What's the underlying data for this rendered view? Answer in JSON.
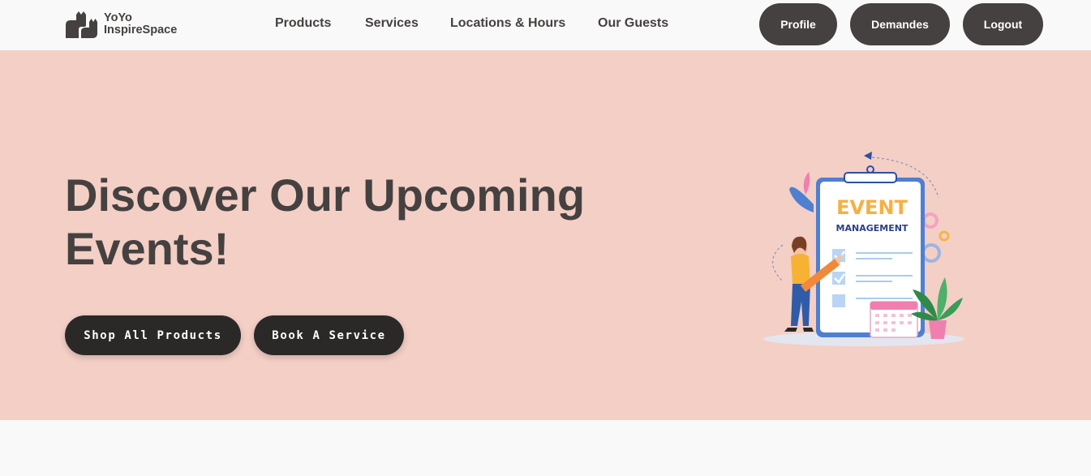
{
  "brand": {
    "line1": "YoYo",
    "line2": "InspireSpace",
    "logo_icon": "cat-logo-icon"
  },
  "nav": {
    "links": [
      "Products",
      "Services",
      "Locations & Hours",
      "Our Guests"
    ],
    "buttons": [
      "Profile",
      "Demandes",
      "Logout"
    ]
  },
  "hero": {
    "title_line1": "Discover Our Upcoming",
    "title_line2": "Events!",
    "buttons": [
      "Shop All Products",
      "Book A Service"
    ],
    "illustration": {
      "icon": "event-management-illustration",
      "word1": "EVENT",
      "word2": "MANAGEMENT"
    }
  },
  "colors": {
    "hero_bg": "#f3cfc6",
    "nav_button": "#454140",
    "hero_button": "#2b2828",
    "text": "#454140"
  }
}
